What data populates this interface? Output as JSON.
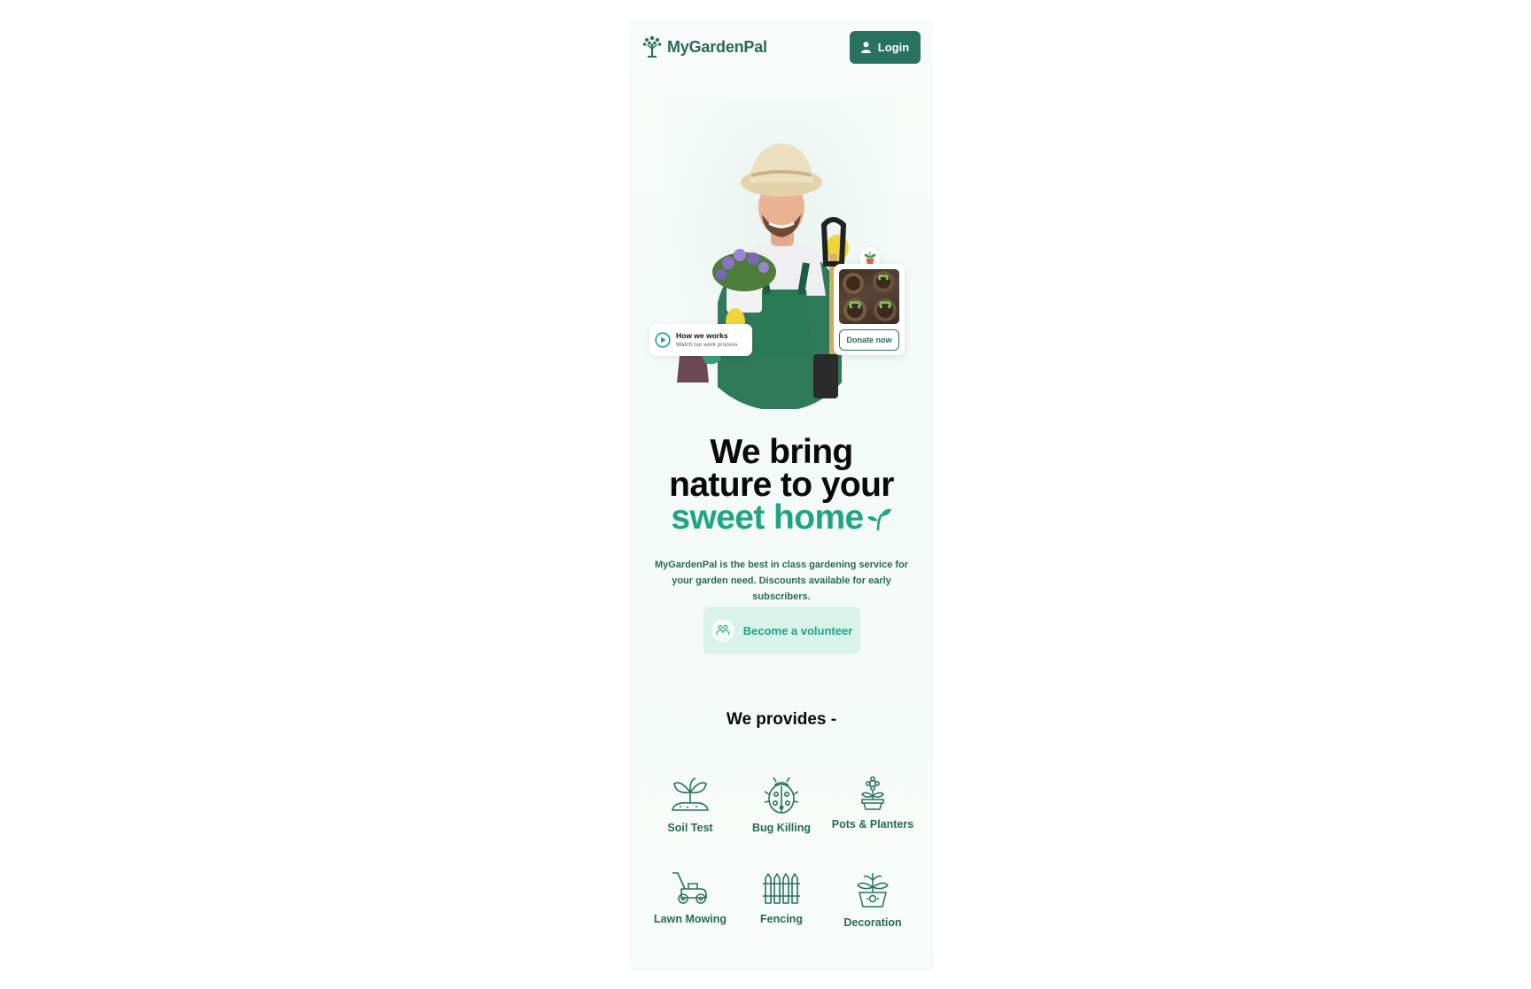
{
  "header": {
    "brand": "MyGardenPal",
    "login_label": "Login"
  },
  "hero": {
    "how_title": "How we works",
    "how_subtitle": "Watch our work process",
    "donate_label": "Donate now"
  },
  "headline": {
    "line1": "We bring",
    "line2": "nature to your",
    "line3": "sweet home"
  },
  "description": "MyGardenPal is the best in class gardening service for your garden need. Discounts available for early subscribers.",
  "volunteer_label": "Become a volunteer",
  "services": {
    "title": "We provides -",
    "items": [
      {
        "label": "Soil Test",
        "icon": "soil-test-icon"
      },
      {
        "label": "Bug Killing",
        "icon": "bug-icon"
      },
      {
        "label": "Pots & Planters",
        "icon": "pot-plant-icon"
      },
      {
        "label": "Lawn Mowing",
        "icon": "lawn-mower-icon"
      },
      {
        "label": "Fencing",
        "icon": "fence-icon"
      },
      {
        "label": "Decoration",
        "icon": "decoration-icon"
      }
    ]
  },
  "colors": {
    "brand": "#2a7260",
    "accent": "#1ea583",
    "accent_light": "#d9f3ea"
  }
}
